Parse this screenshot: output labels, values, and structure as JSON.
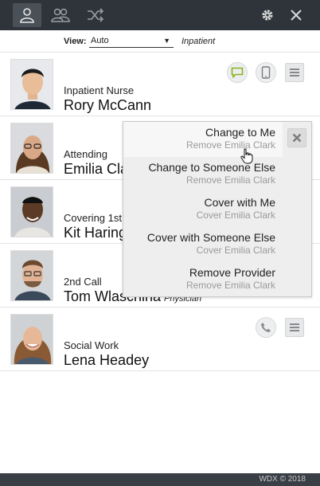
{
  "topbar": {
    "icons": [
      "person-icon",
      "group-icon",
      "shuffle-icon",
      "gear-icon",
      "close-icon"
    ]
  },
  "viewbar": {
    "label": "View:",
    "value": "Auto",
    "note": "Inpatient"
  },
  "providers": [
    {
      "role": "Inpatient Nurse",
      "name": "Rory McCann",
      "subtitle": ""
    },
    {
      "role": "Attending",
      "name": "Emilia Clark",
      "subtitle": ""
    },
    {
      "role": "Covering 1st",
      "name": "Kit Harington",
      "subtitle": ""
    },
    {
      "role": "2nd Call",
      "name": "Tom Wlaschiha",
      "subtitle": "Physician"
    },
    {
      "role": "Social Work",
      "name": "Lena Headey",
      "subtitle": ""
    }
  ],
  "menu": {
    "items": [
      {
        "label": "Change to Me",
        "sub": "Remove Emilia Clark"
      },
      {
        "label": "Change to Someone Else",
        "sub": "Remove Emilia Clark"
      },
      {
        "label": "Cover with Me",
        "sub": "Cover Emilia Clark"
      },
      {
        "label": "Cover with Someone Else",
        "sub": "Cover Emilia Clark"
      },
      {
        "label": "Remove Provider",
        "sub": "Remove Emilia Clark"
      }
    ]
  },
  "footer": {
    "text": "WDX © 2018"
  },
  "colors": {
    "topbar": "#2f343b",
    "chat_icon": "#8ab31e",
    "footer": "#3a3f46"
  }
}
